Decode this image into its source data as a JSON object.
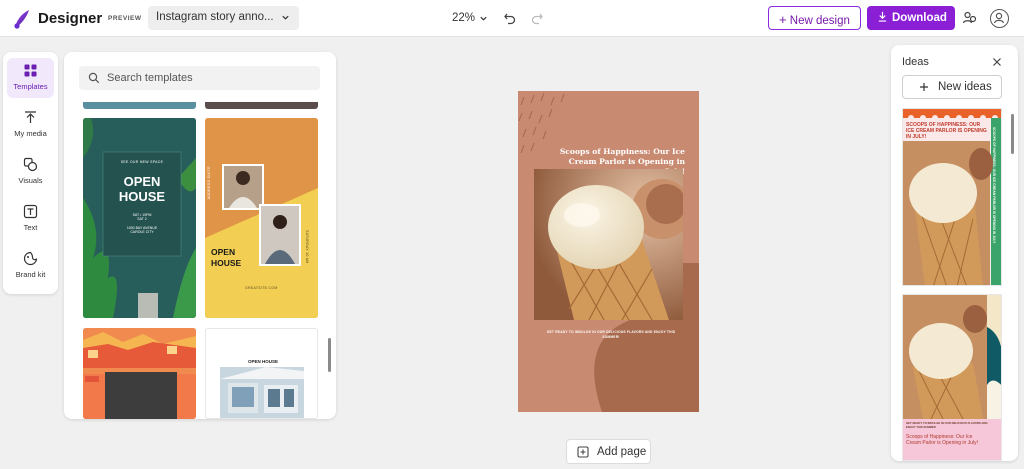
{
  "app": {
    "brand": "Designer",
    "badge": "PREVIEW",
    "document_name": "Instagram story anno...",
    "zoom": "22%"
  },
  "toolbar": {
    "new_design_label": "New design",
    "download_label": "Download"
  },
  "rail": {
    "items": [
      {
        "label": "Templates",
        "icon": "templates-icon",
        "active": true
      },
      {
        "label": "My media",
        "icon": "upload-icon"
      },
      {
        "label": "Visuals",
        "icon": "shapes-icon"
      },
      {
        "label": "Text",
        "icon": "text-icon"
      },
      {
        "label": "Brand kit",
        "icon": "brand-kit-icon"
      }
    ]
  },
  "templates": {
    "search_placeholder": "Search templates",
    "cards": [
      {
        "lines": [
          "SEE OUR NEW SPACE",
          "OPEN",
          "HOUSE",
          "SAT • 10PM",
          "SAT 2",
          "1000 BAY AVENUE",
          "CAROLE CITY"
        ]
      },
      {
        "lines": [
          "ADDRESS SUITE",
          "OPEN",
          "HOUSE",
          "GREATSITE.COM",
          "SATURDAY 10 AM"
        ]
      },
      {
        "lines": []
      },
      {
        "lines": [
          "OPEN HOUSE"
        ]
      }
    ]
  },
  "canvas": {
    "title": "Scoops of Happiness: Our Ice Cream Parlor is Opening in July!",
    "body": "GET READY TO INDULGE IN OUR DELICIOUS FLAVORS AND ENJOY THIS SUMMER!"
  },
  "add_page_label": "Add page",
  "ideas": {
    "title": "Ideas",
    "new_ideas_label": "New ideas",
    "items": [
      {
        "title": "SCOOPS OF HAPPINESS: OUR ICE CREAM PARLOR IS OPENING IN JULY!",
        "side": "SCOOPS OF HAPPINESS: OUR ICE CREAM PARLOR IS OPENING IN JULY"
      },
      {
        "title": "Scoops of Happiness: Our Ice Cream Parlor is Opening in July!",
        "caption": "GET READY TO INDULGE IN OUR DELICIOUS FLAVORS AND ENJOY THIS SUMMER"
      }
    ]
  },
  "colors": {
    "accent": "#8a1fd6",
    "canvas_bg": "#c98a72"
  }
}
